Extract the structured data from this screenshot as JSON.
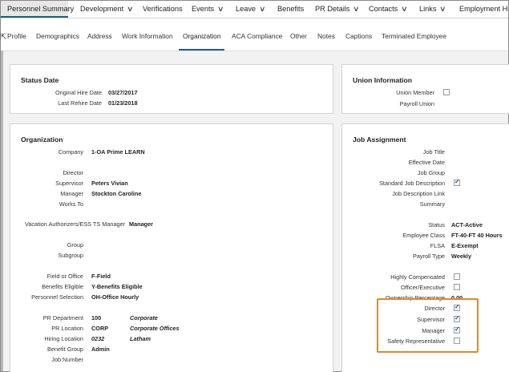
{
  "top_nav": [
    {
      "label": "Personnel Summary",
      "active": true,
      "chevron": false
    },
    {
      "label": "Development",
      "chevron": true
    },
    {
      "label": "Verifications",
      "chevron": false
    },
    {
      "label": "Events",
      "chevron": true
    },
    {
      "label": "Leave",
      "chevron": true
    },
    {
      "label": "Benefits",
      "chevron": false
    },
    {
      "label": "PR Details",
      "chevron": true
    },
    {
      "label": "Contacts",
      "chevron": true
    },
    {
      "label": "Links",
      "chevron": true
    },
    {
      "label": "Employment Hist",
      "chevron": false
    }
  ],
  "sub_nav": [
    "Profile",
    "Demographics",
    "Address",
    "Work Information",
    "Organization",
    "ACA Compliance",
    "Other",
    "Notes",
    "Captions",
    "Terminated Employee"
  ],
  "active_sub_tab": "Organization",
  "status_date": {
    "title": "Status Date",
    "original_hire_label": "Original Hire Date",
    "original_hire_value": "03/27/2017",
    "rehire_label": "Last Rehire Date",
    "rehire_value": "01/23/2018"
  },
  "union": {
    "title": "Union Information",
    "member_label": "Union Member",
    "member_checked": false,
    "payroll_label": "Payroll Union"
  },
  "organization": {
    "title": "Organization",
    "company_label": "Company",
    "company_value": "1-OA Prime LEARN",
    "director_label": "Director",
    "supervisor_label": "Supervisor",
    "supervisor_value": "Peters Vivian",
    "manager_label": "Manager",
    "manager_value": "Stockton Caroline",
    "works_to_label": "Works To",
    "vacation_label": "Vacation Authorizers/ESS TS Manager",
    "vacation_value": "Manager",
    "group_label": "Group",
    "subgroup_label": "Subgroup",
    "field_office_label": "Field or Office",
    "field_office_value": "F-Field",
    "benefits_label": "Benefits Eligible",
    "benefits_value": "Y-Benefits Eligible",
    "personnel_label": "Personnel Selection",
    "personnel_value": "OH-Office Hourly",
    "pr_dept_label": "PR Department",
    "pr_dept_code": "100",
    "pr_dept_desc": "Corporate",
    "pr_loc_label": "PR Location",
    "pr_loc_code": "CORP",
    "pr_loc_desc": "Corporate Offices",
    "hiring_loc_label": "Hiring Location",
    "hiring_loc_code": "0232",
    "hiring_loc_desc": "Latham",
    "benefit_group_label": "Benefit Group",
    "benefit_group_value": "Admin",
    "job_number_label": "Job Number"
  },
  "job_assignment": {
    "title": "Job Assignment",
    "job_title_label": "Job Title",
    "effective_date_label": "Effective Date",
    "job_group_label": "Job Group",
    "std_desc_label": "Standard Job Description",
    "std_desc_checked": true,
    "desc_link_label": "Job Description Link",
    "summary_label": "Summary",
    "status_label": "Status",
    "status_value": "ACT-Active",
    "emp_class_label": "Employee Class",
    "emp_class_value": "FT-40-FT 40 Hours",
    "flsa_label": "FLSA",
    "flsa_value": "E-Exempt",
    "payroll_type_label": "Payroll Type",
    "payroll_type_value": "Weekly",
    "highly_comp_label": "Highly Compensated",
    "highly_comp_checked": false,
    "officer_label": "Officer/Executive",
    "officer_checked": false,
    "ownership_label": "Ownership Percentage",
    "ownership_value": "0.00",
    "director_label": "Director",
    "director_checked": true,
    "supervisor_label": "Supervisor",
    "supervisor_checked": true,
    "manager_label": "Manager",
    "manager_checked": true,
    "safety_label": "Safety Representative",
    "safety_checked": false
  },
  "colors": {
    "nav_accent": "#1f5f8b",
    "highlight_box": "#e4872b",
    "page_bg": "#f2f2f2"
  },
  "icons": {
    "chevron": "chevron-down-icon",
    "checkbox_checked": "check-icon",
    "cursor": "mouse-cursor-icon"
  }
}
